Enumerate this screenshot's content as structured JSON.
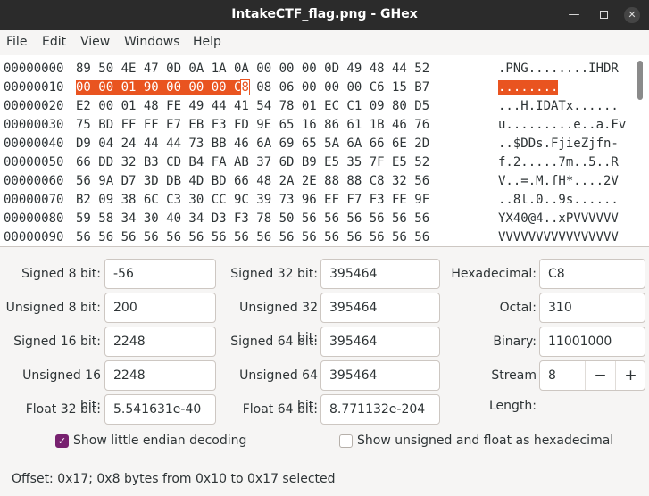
{
  "window": {
    "title": "IntakeCTF_flag.png - GHex",
    "minimize_icon": "minimize-icon",
    "maximize_icon": "maximize-icon",
    "close_icon": "close-icon"
  },
  "menu": [
    "File",
    "Edit",
    "View",
    "Windows",
    "Help"
  ],
  "hex_rows": [
    {
      "offset": "00000000",
      "hex": "89 50 4E 47 0D 0A 1A 0A 00 00 00 0D 49 48 44 52",
      "ascii": ".PNG........IHDR"
    },
    {
      "offset": "00000010",
      "hex_selected": "00 00 01 90 00 00 00 C",
      "hex_cursor": "8",
      "hex_rest": " 08 06 00 00 00 C6 15 B7",
      "ascii_pre": "",
      "ascii_selected": "........",
      "ascii_post": ""
    },
    {
      "offset": "00000020",
      "hex": "E2 00 01 48 FE 49 44 41 54 78 01 EC C1 09 80 D5",
      "ascii": "...H.IDATx......"
    },
    {
      "offset": "00000030",
      "hex": "75 BD FF FF E7 EB F3 FD 9E 65 16 86 61 1B 46 76",
      "ascii": "u.........e..a.Fv"
    },
    {
      "offset": "00000040",
      "hex": "D9 04 24 44 44 73 BB 46 6A 69 65 5A 6A 66 6E 2D",
      "ascii": "..$DDs.FjieZjfn-"
    },
    {
      "offset": "00000050",
      "hex": "66 DD 32 B3 CD B4 FA AB 37 6D B9 E5 35 7F E5 52",
      "ascii": "f.2.....7m..5..R"
    },
    {
      "offset": "00000060",
      "hex": "56 9A D7 3D DB 4D BD 66 48 2A 2E 88 88 C8 32 56",
      "ascii": "V..=.M.fH*....2V"
    },
    {
      "offset": "00000070",
      "hex": "B2 09 38 6C C3 30 CC 9C 39 73 96 EF F7 F3 FE 9F",
      "ascii": "..8l.0..9s......"
    },
    {
      "offset": "00000080",
      "hex": "59 58 34 30 40 34 D3 F3 78 50 56 56 56 56 56 56",
      "ascii": "YX40@4..xPVVVVVV"
    },
    {
      "offset": "00000090",
      "hex": "56 56 56 56 56 56 56 56 56 56 56 56 56 56 56 56",
      "ascii": "VVVVVVVVVVVVVVVV"
    }
  ],
  "inspector": {
    "signed8_label": "Signed 8 bit:",
    "signed8": "-56",
    "unsigned8_label": "Unsigned 8 bit:",
    "unsigned8": "200",
    "signed16_label": "Signed 16 bit:",
    "signed16": "2248",
    "unsigned16_label": "Unsigned 16 bit:",
    "unsigned16": "2248",
    "float32_label": "Float 32 bit:",
    "float32": "5.541631e-40",
    "signed32_label": "Signed 32 bit:",
    "signed32": "395464",
    "unsigned32_label": "Unsigned 32 bit:",
    "unsigned32": "395464",
    "signed64_label": "Signed 64 bit:",
    "signed64": "395464",
    "unsigned64_label": "Unsigned 64 bit:",
    "unsigned64": "395464",
    "float64_label": "Float 64 bit:",
    "float64": "8.771132e-204",
    "hex_label": "Hexadecimal:",
    "hex": "C8",
    "octal_label": "Octal:",
    "octal": "310",
    "binary_label": "Binary:",
    "binary": "11001000",
    "stream_label": "Stream Length:",
    "stream": "8",
    "stream_minus": "−",
    "stream_plus": "+"
  },
  "options": {
    "little_endian_label": "Show little endian decoding",
    "little_endian_checked": true,
    "unsigned_hex_label": "Show unsigned and float as hexadecimal",
    "unsigned_hex_checked": false
  },
  "status": "Offset: 0x17; 0x8 bytes from 0x10 to 0x17 selected",
  "colors": {
    "selection": "#e95420",
    "checkbox": "#77216f",
    "titlebar": "#2b2b2b"
  }
}
